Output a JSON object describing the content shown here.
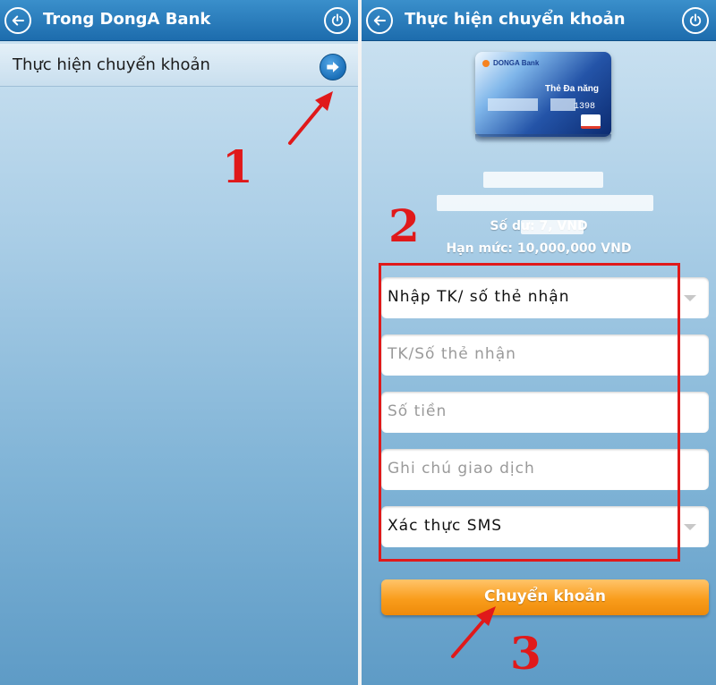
{
  "left_screen": {
    "header": {
      "title": "Trong DongA Bank"
    },
    "menu": {
      "item_label": "Thực hiện chuyển khoản"
    },
    "annotation_number": "1"
  },
  "right_screen": {
    "header": {
      "title": "Thực hiện chuyển khoản"
    },
    "card": {
      "bank_name": "DONGA Bank",
      "card_type": "Thẻ Đa năng",
      "card_number_visible": "1398"
    },
    "account": {
      "balance_text": "Số dư: 7,       VND",
      "limit_text": "Hạn mức: 10,000,000 VND"
    },
    "form": {
      "recipient_select": "Nhập TK/ số thẻ nhận",
      "recipient_placeholder": "TK/Số thẻ nhận",
      "amount_placeholder": "Số tiền",
      "note_placeholder": "Ghi chú giao dịch",
      "auth_select": "Xác thực SMS"
    },
    "submit_label": "Chuyển khoản",
    "annotation_number_form": "2",
    "annotation_number_submit": "3"
  },
  "colors": {
    "header_blue": "#1d6cad",
    "annotation_red": "#e0191a",
    "button_orange": "#f99d1c"
  },
  "icons": [
    "back-arrow-icon",
    "power-icon",
    "arrow-right-icon",
    "dropdown-caret-icon"
  ]
}
